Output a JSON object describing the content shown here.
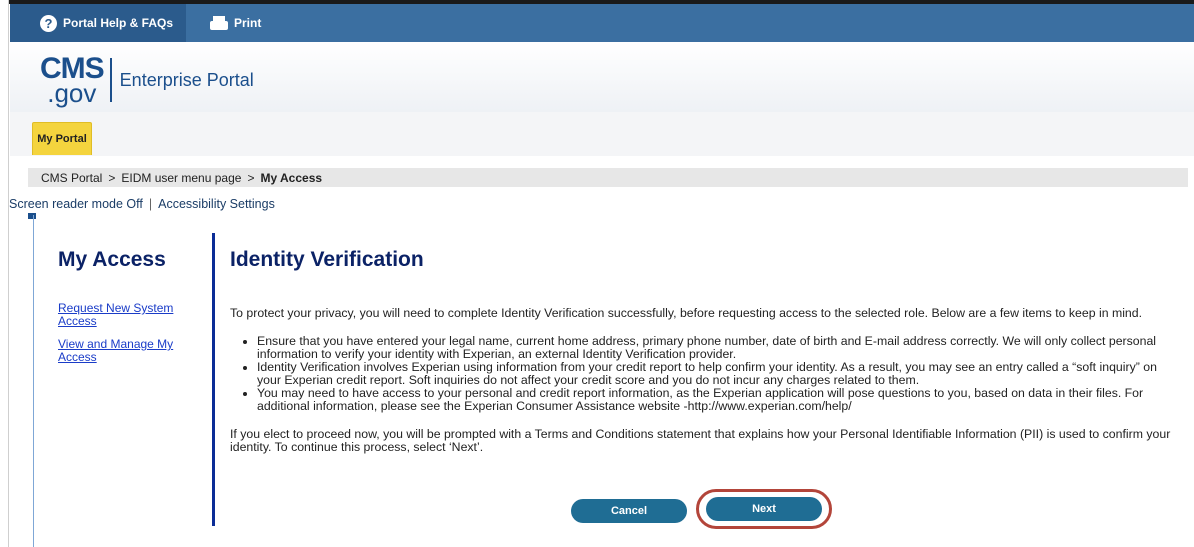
{
  "topbar": {
    "help_label": "Portal Help & FAQs",
    "print_label": "Print",
    "help_icon": "question-circle-icon",
    "print_icon": "printer-icon"
  },
  "logo": {
    "cms": "CMS",
    "gov": ".gov",
    "title": "Enterprise Portal"
  },
  "tabs": {
    "my_portal": "My Portal"
  },
  "breadcrumb": {
    "items": [
      "CMS Portal",
      "EIDM user menu page",
      "My Access"
    ],
    "separator": ">"
  },
  "accessibility": {
    "screen_reader": "Screen reader mode Off",
    "settings": "Accessibility Settings"
  },
  "sidebar": {
    "title": "My Access",
    "links": [
      "Request New System Access",
      "View and Manage My Access"
    ]
  },
  "main": {
    "title": "Identity Verification",
    "intro": "To protect your privacy, you will need to complete Identity Verification successfully, before requesting access to the selected role. Below are a few items to keep in mind.",
    "bullets": [
      "Ensure that you have entered your legal name, current home address, primary phone number, date of birth and E-mail address correctly. We will only collect personal information to verify your identity with Experian, an external Identity Verification provider.",
      "Identity Verification involves Experian using information from your credit report to help confirm your identity. As a result, you may see an entry called a “soft inquiry” on your Experian credit report. Soft inquiries do not affect your credit score and you do not incur any charges related to them.",
      "You may need to have access to your personal and credit report information, as the Experian application will pose questions to you, based on data in their files. For additional information, please see the Experian Consumer Assistance website -http://www.experian.com/help/"
    ],
    "closing": "If you elect to proceed now, you will be prompted with a Terms and Conditions statement that explains how your Personal Identifiable Information (PII) is used to confirm your identity. To continue this process, select ‘Next’."
  },
  "buttons": {
    "cancel": "Cancel",
    "next": "Next"
  },
  "colors": {
    "topbar": "#3b6fa1",
    "tab_active": "#f4d43e",
    "heading": "#0b2266",
    "button": "#1f6d94",
    "highlight": "#b3453a"
  }
}
